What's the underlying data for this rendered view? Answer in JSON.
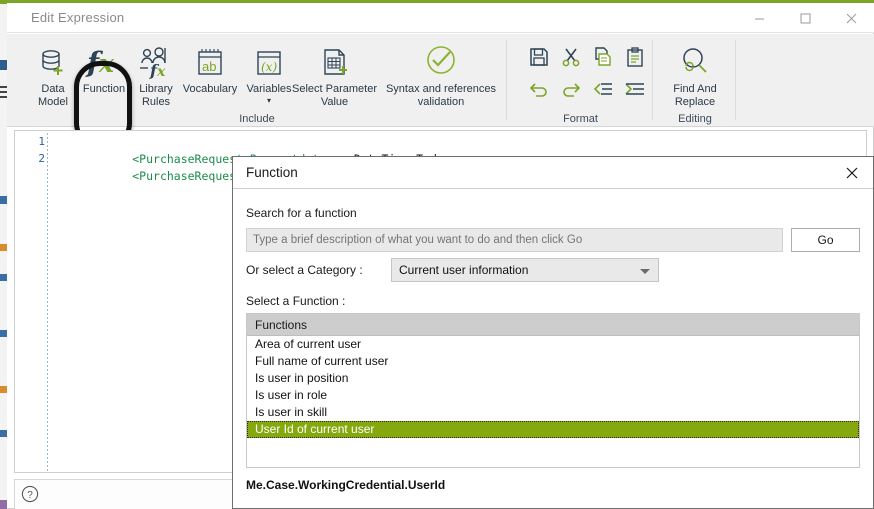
{
  "window": {
    "title": "Edit Expression",
    "accent_color": "#7ba428",
    "controls": {
      "minimize": "minimize-button",
      "maximize": "maximize-button",
      "close": "close-button"
    }
  },
  "ribbon": {
    "groups": [
      {
        "name": "Include",
        "items": [
          {
            "label": "Data\nModel",
            "icon": "database-plus-icon"
          },
          {
            "label": "Function",
            "icon": "fx-icon"
          },
          {
            "label": "Library\nRules",
            "icon": "library-rules-icon"
          },
          {
            "label": "Vocabulary",
            "icon": "vocabulary-ab-icon"
          },
          {
            "label": "Variables",
            "icon": "variables-x-icon",
            "caret": "▾"
          },
          {
            "label": "Select Parameter\nValue",
            "icon": "select-parameter-icon"
          },
          {
            "label": "Syntax and references\nvalidation",
            "icon": "check-circle-icon"
          }
        ]
      },
      {
        "name": "Format",
        "items": [
          {
            "label": "save-icon",
            "icon": "save-icon"
          },
          {
            "label": "cut-icon",
            "icon": "cut-icon"
          },
          {
            "label": "copy-icon",
            "icon": "copy-icon"
          },
          {
            "label": "paste-icon",
            "icon": "paste-icon"
          },
          {
            "label": "undo-icon",
            "icon": "undo-icon"
          },
          {
            "label": "redo-icon",
            "icon": "redo-icon"
          },
          {
            "label": "outdent-icon",
            "icon": "outdent-icon"
          },
          {
            "label": "indent-icon",
            "icon": "indent-icon"
          }
        ]
      },
      {
        "name": "Editing",
        "items": [
          {
            "label": "Find And\nReplace",
            "icon": "find-replace-icon"
          }
        ]
      }
    ]
  },
  "editor": {
    "lines": [
      {
        "number": "1",
        "segments": [
          {
            "text": "<PurchaseRequest.Requestdate>",
            "cls": "tok-tag"
          },
          {
            "text": " = ",
            "cls": "tok-op"
          },
          {
            "text": "DateTime.Today;",
            "cls": "tok-id"
          }
        ]
      },
      {
        "number": "2",
        "segments": [
          {
            "text": "<PurchaseRequest.Requestedby>",
            "cls": "tok-tag"
          }
        ]
      }
    ]
  },
  "statusbar": {
    "help": "help-icon"
  },
  "dialog": {
    "title": "Function",
    "close_label": "✕",
    "search": {
      "label": "Search for a function",
      "value": "",
      "placeholder": "Type a brief description of what you want to do and then click Go",
      "go_label": "Go"
    },
    "category": {
      "label": "Or select a Category :",
      "selected": "Current user information"
    },
    "function_list": {
      "label": "Select a Function :",
      "column_header": "Functions",
      "selected_index": 5,
      "highlight_color": "#84a80d",
      "items": [
        "Area of current user",
        "Full name of current user",
        "Is user in position",
        "Is user in role",
        "Is user in skill",
        "User Id of current user"
      ]
    },
    "formula": "Me.Case.WorkingCredential.UserId"
  }
}
